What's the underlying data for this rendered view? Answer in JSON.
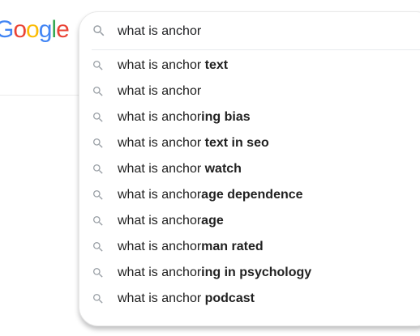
{
  "logo": {
    "letters": [
      {
        "char": "G",
        "color": "#4285f4"
      },
      {
        "char": "o",
        "color": "#ea4335"
      },
      {
        "char": "o",
        "color": "#fbbc05"
      },
      {
        "char": "g",
        "color": "#4285f4"
      },
      {
        "char": "l",
        "color": "#34a853"
      },
      {
        "char": "e",
        "color": "#ea4335"
      }
    ]
  },
  "search": {
    "icon": "search-icon",
    "value": "what is anchor"
  },
  "suggestions": [
    {
      "prefix": "what is anchor ",
      "bold": "text",
      "icon": "search-icon"
    },
    {
      "prefix": "what is anchor",
      "bold": "",
      "icon": "search-icon"
    },
    {
      "prefix": "what is anchor",
      "bold": "ing bias",
      "icon": "search-icon"
    },
    {
      "prefix": "what is anchor ",
      "bold": "text in seo",
      "icon": "search-icon"
    },
    {
      "prefix": "what is anchor ",
      "bold": "watch",
      "icon": "search-icon"
    },
    {
      "prefix": "what is anchor",
      "bold": "age dependence",
      "icon": "search-icon"
    },
    {
      "prefix": "what is anchor",
      "bold": "age",
      "icon": "search-icon"
    },
    {
      "prefix": "what is anchor",
      "bold": "man rated",
      "icon": "search-icon"
    },
    {
      "prefix": "what is anchor",
      "bold": "ing in psychology",
      "icon": "search-icon"
    },
    {
      "prefix": "what is anchor ",
      "bold": "podcast",
      "icon": "search-icon"
    }
  ]
}
